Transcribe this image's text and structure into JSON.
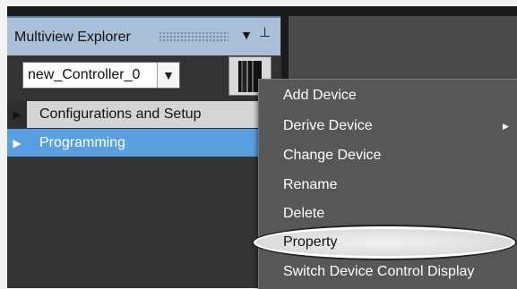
{
  "explorer": {
    "title": "Multiview Explorer",
    "dropdown_icon": "triangle-down-icon",
    "pin_icon": "pin-icon",
    "controller": {
      "selected": "new_Controller_0",
      "arrow_icon": "triangle-down-icon"
    },
    "device_image": "controller-device-image",
    "tree": [
      {
        "label": "Configurations and Setup",
        "expander": "▶"
      },
      {
        "label": "Programming",
        "expander": "▶"
      }
    ]
  },
  "context_menu": {
    "items": [
      {
        "label": "Add Device"
      },
      {
        "label": "Derive Device",
        "has_submenu": true
      },
      {
        "label": "Change Device"
      },
      {
        "label": "Rename"
      },
      {
        "label": "Delete"
      },
      {
        "label": "Property",
        "highlighted": true
      },
      {
        "label": "Switch Device Control Display"
      }
    ]
  },
  "colors": {
    "header_bg": "#a9bfd8",
    "selected_row": "#5a9fe0",
    "menu_bg": "#575757"
  }
}
